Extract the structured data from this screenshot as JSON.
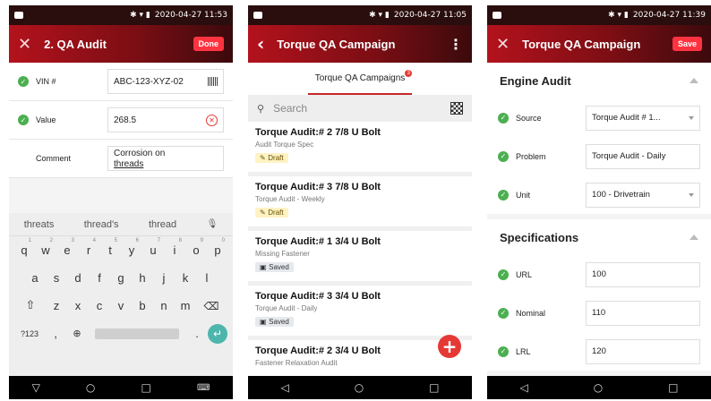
{
  "phones": [
    {
      "status_time": "2020-04-27 11:53",
      "title": "2. QA Audit",
      "action": "Done",
      "fields": [
        {
          "label": "VIN #",
          "value": "ABC-123-XYZ-02"
        },
        {
          "label": "Value",
          "value": "268.5"
        },
        {
          "label": "Comment",
          "value_line1": "Corrosion on",
          "value_line2": "threads"
        }
      ],
      "keyboard": {
        "suggestions": [
          "threats",
          "thread's",
          "thread"
        ],
        "row1": [
          "q",
          "w",
          "e",
          "r",
          "t",
          "y",
          "u",
          "i",
          "o",
          "p"
        ],
        "row1_nums": [
          "1",
          "2",
          "3",
          "4",
          "5",
          "6",
          "7",
          "8",
          "9",
          "0"
        ],
        "row2": [
          "a",
          "s",
          "d",
          "f",
          "g",
          "h",
          "j",
          "k",
          "l"
        ],
        "row3": [
          "z",
          "x",
          "c",
          "v",
          "b",
          "n",
          "m"
        ],
        "symbols_key": "?123",
        "comma": ",",
        "period": "."
      }
    },
    {
      "status_time": "2020-04-27 11:05",
      "title": "Torque QA Campaign",
      "tab_label": "Torque QA Campaigns",
      "tab_badge": "3",
      "search_placeholder": "Search",
      "items": [
        {
          "title": "Torque Audit:# 2 7/8 U Bolt",
          "subtitle": "Audit Torque Spec",
          "status": "Draft"
        },
        {
          "title": "Torque Audit:# 3 7/8 U Bolt",
          "subtitle": "Torque Audit - Weekly",
          "status": "Draft"
        },
        {
          "title": "Torque Audit:# 1 3/4 U Bolt",
          "subtitle": "Missing Fastener",
          "status": "Saved"
        },
        {
          "title": "Torque Audit:# 3 3/4 U Bolt",
          "subtitle": "Torque Audit - Daily",
          "status": "Saved"
        },
        {
          "title": "Torque Audit:# 2 3/4 U Bolt",
          "subtitle": "Fastener Relaxation Audit",
          "status": ""
        }
      ]
    },
    {
      "status_time": "2020-04-27 11:39",
      "title": "Torque QA Campaign",
      "action": "Save",
      "sections": [
        {
          "heading": "Engine Audit",
          "fields": [
            {
              "label": "Source",
              "value": "Torque Audit # 1..."
            },
            {
              "label": "Problem",
              "value": "Torque Audit - Daily"
            },
            {
              "label": "Unit",
              "value": "100 - Drivetrain"
            }
          ]
        },
        {
          "heading": "Specifications",
          "fields": [
            {
              "label": "URL",
              "value": "100"
            },
            {
              "label": "Nominal",
              "value": "110"
            },
            {
              "label": "LRL",
              "value": "120"
            }
          ]
        }
      ]
    }
  ],
  "colors": {
    "brand_red": "#b3121c",
    "check_green": "#4caf50",
    "fab_red": "#e53935"
  }
}
